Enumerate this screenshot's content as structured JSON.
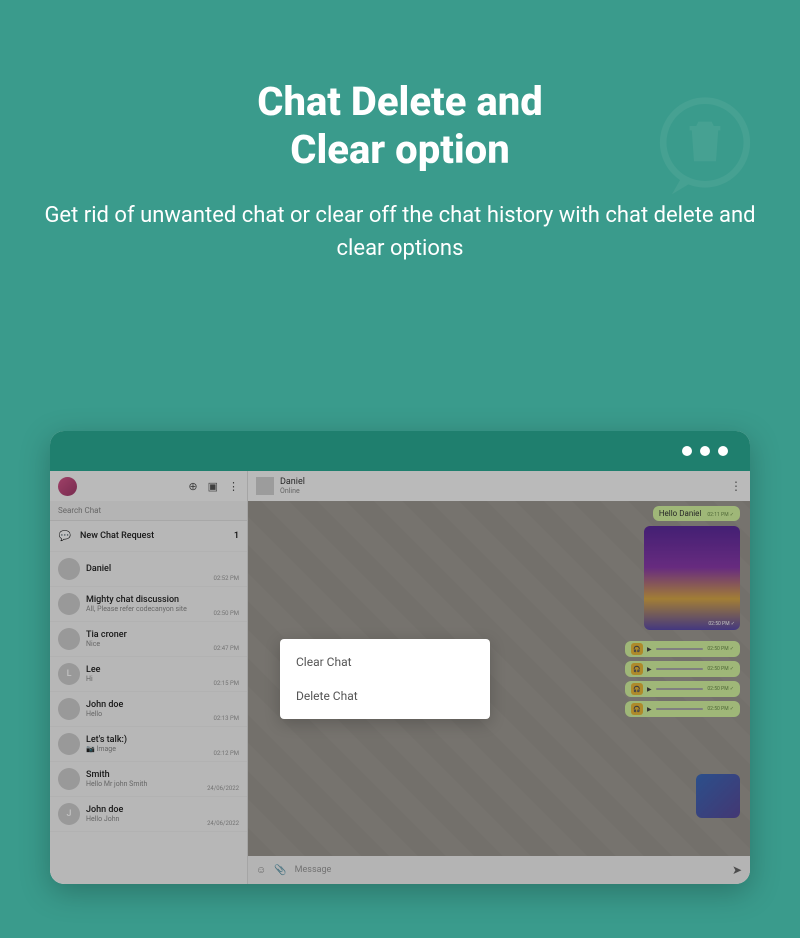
{
  "hero": {
    "title_l1": "Chat Delete and",
    "title_l2": "Clear option",
    "subtitle": "Get rid of unwanted chat or clear off the chat history with chat delete and clear options"
  },
  "sidebar": {
    "search_placeholder": "Search Chat",
    "new_request_label": "New Chat Request",
    "new_request_count": "1",
    "items": [
      {
        "name": "Daniel",
        "msg": "",
        "time": "02:52 PM"
      },
      {
        "name": "Mighty chat discussion",
        "msg": "All, Please refer codecanyon site",
        "time": "02:50 PM"
      },
      {
        "name": "Tia croner",
        "msg": "Nice",
        "time": "02:47 PM"
      },
      {
        "name": "Lee",
        "msg": "Hi",
        "time": "02:15 PM"
      },
      {
        "name": "John doe",
        "msg": "Hello",
        "time": "02:13 PM"
      },
      {
        "name": "Let's talk:)",
        "msg": "📷 Image",
        "time": "02:12 PM"
      },
      {
        "name": "Smith",
        "msg": "Hello Mr john Smith",
        "time": "24/06/2022"
      },
      {
        "name": "John doe",
        "msg": "Hello John",
        "time": "24/06/2022"
      }
    ]
  },
  "chat": {
    "header": {
      "name": "Daniel",
      "status": "Online"
    },
    "hello": {
      "text": "Hello Daniel",
      "time": "02:11 PM ✓"
    },
    "photo_time": "02:50 PM ✓",
    "audio_time": "02:50 PM ✓",
    "input_placeholder": "Message"
  },
  "menu": {
    "clear": "Clear Chat",
    "delete": "Delete Chat"
  }
}
